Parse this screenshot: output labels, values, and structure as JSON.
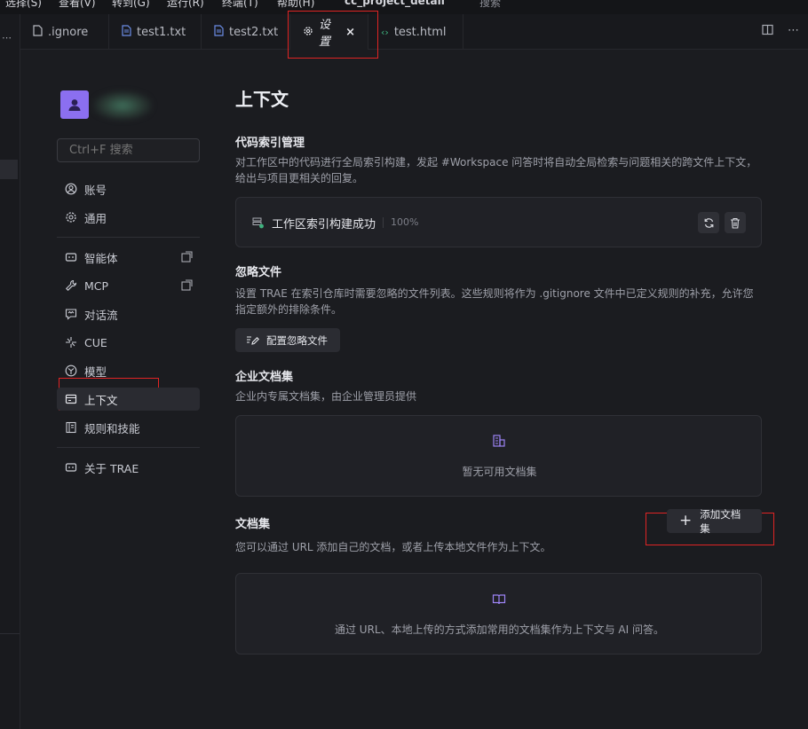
{
  "window": {
    "menu_items": [
      "选择(S)",
      "查看(V)",
      "转到(G)",
      "运行(R)",
      "终端(T)",
      "帮助(H)",
      "cc_project_detail",
      "搜索"
    ]
  },
  "tabs": [
    {
      "label": ".ignore",
      "icon": "file-icon"
    },
    {
      "label": "test1.txt",
      "icon": "text-file-icon"
    },
    {
      "label": "test2.txt",
      "icon": "text-file-icon"
    },
    {
      "label": "设置",
      "icon": "gear-icon",
      "active": true
    },
    {
      "label": "test.html",
      "icon": "code-icon"
    }
  ],
  "sidebar": {
    "search_placeholder": "Ctrl+F 搜索",
    "items": [
      {
        "label": "账号",
        "icon": "user-circle-icon"
      },
      {
        "label": "通用",
        "icon": "gear-icon"
      },
      {
        "label": "智能体",
        "icon": "robot-icon",
        "external": true
      },
      {
        "label": "MCP",
        "icon": "wrench-icon",
        "external": true
      },
      {
        "label": "对话流",
        "icon": "chat-icon"
      },
      {
        "label": "CUE",
        "icon": "cue-icon"
      },
      {
        "label": "模型",
        "icon": "model-icon"
      },
      {
        "label": "上下文",
        "icon": "context-icon",
        "active": true
      },
      {
        "label": "规则和技能",
        "icon": "book-icon"
      },
      {
        "label": "关于 TRAE",
        "icon": "info-icon"
      }
    ]
  },
  "main": {
    "title": "上下文",
    "code_index": {
      "heading": "代码索引管理",
      "description": "对工作区中的代码进行全局索引构建，发起 #Workspace 问答时将自动全局检索与问题相关的跨文件上下文，给出与项目更相关的回复。",
      "status": "工作区索引构建成功",
      "progress": "100%"
    },
    "ignore_files": {
      "heading": "忽略文件",
      "description": "设置 TRAE 在索引仓库时需要忽略的文件列表。这些规则将作为 .gitignore 文件中已定义规则的补充，允许您指定额外的排除条件。",
      "button": "配置忽略文件"
    },
    "enterprise_docs": {
      "heading": "企业文档集",
      "description": "企业内专属文档集，由企业管理员提供",
      "empty": "暂无可用文档集"
    },
    "docs": {
      "heading": "文档集",
      "add_button": "添加文档集",
      "description": "您可以通过 URL 添加自己的文档，或者上传本地文件作为上下文。",
      "empty": "通过 URL、本地上传的方式添加常用的文档集作为上下文与 AI 问答。"
    }
  },
  "colors": {
    "accent": "#8b6ff0",
    "highlight_box": "#e02424",
    "success": "#3fb27f"
  }
}
